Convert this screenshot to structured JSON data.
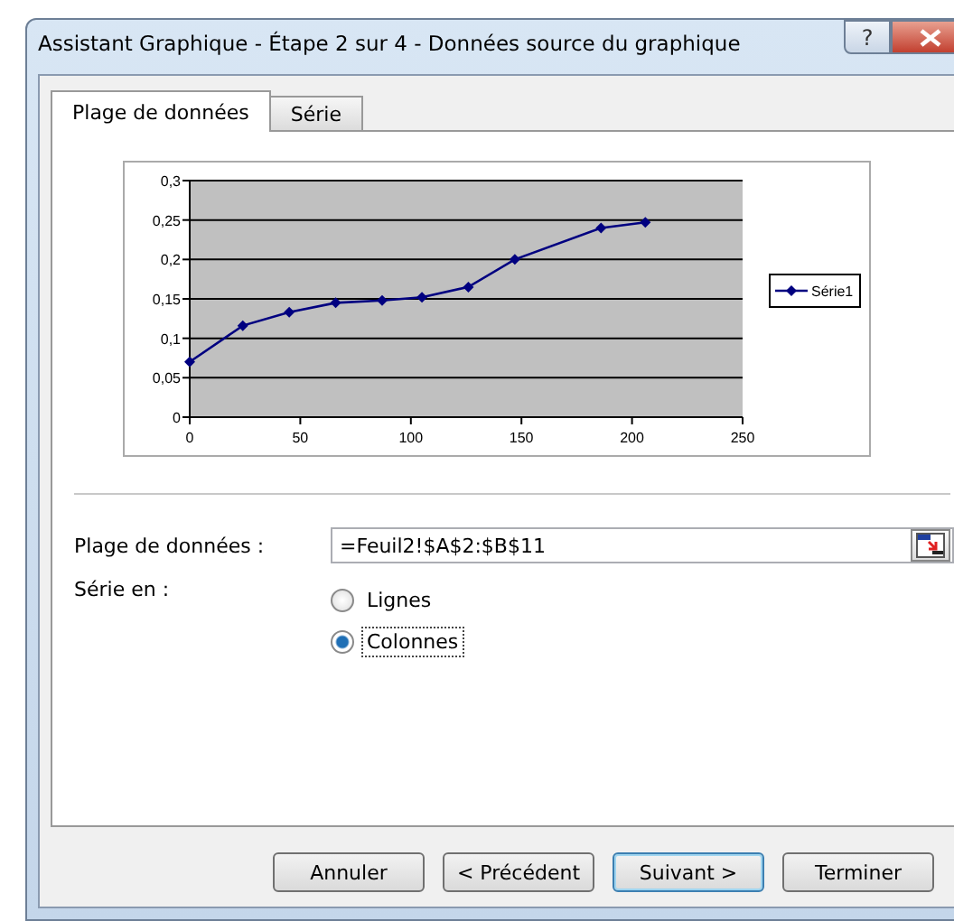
{
  "window": {
    "title": "Assistant Graphique - Étape 2 sur 4 - Données source du graphique",
    "help_button": "?"
  },
  "tabs": [
    {
      "label": "Plage de données",
      "selected": true
    },
    {
      "label": "Série",
      "selected": false
    }
  ],
  "chart": {
    "chart_data": {
      "type": "line",
      "grid": true,
      "x": [
        0,
        24,
        45,
        66,
        87,
        105,
        126,
        147,
        186,
        206
      ],
      "series": [
        {
          "name": "Série1",
          "color": "#000080",
          "marker": "diamond",
          "values": [
            0.07,
            0.116,
            0.133,
            0.145,
            0.148,
            0.152,
            0.165,
            0.2,
            0.24,
            0.247
          ]
        }
      ],
      "xlim": [
        0,
        250
      ],
      "ylim": [
        0,
        0.3
      ],
      "xticks": [
        0,
        50,
        100,
        150,
        200,
        250
      ],
      "yticks": [
        {
          "value": 0,
          "label": "0"
        },
        {
          "value": 0.05,
          "label": "0,05"
        },
        {
          "value": 0.1,
          "label": "0,1"
        },
        {
          "value": 0.15,
          "label": "0,15"
        },
        {
          "value": 0.2,
          "label": "0,2"
        },
        {
          "value": 0.25,
          "label": "0,25"
        },
        {
          "value": 0.3,
          "label": "0,3"
        }
      ]
    }
  },
  "range": {
    "label": "Plage de données :",
    "value": "=Feuil2!$A$2:$B$11"
  },
  "series_in": {
    "label": "Série en :",
    "options": [
      {
        "label": "Lignes",
        "selected": false
      },
      {
        "label": "Colonnes",
        "selected": true
      }
    ]
  },
  "buttons": [
    {
      "label": "Annuler",
      "default": false
    },
    {
      "label": "< Précédent",
      "default": false
    },
    {
      "label": "Suivant >",
      "default": true
    },
    {
      "label": "Terminer",
      "default": false
    }
  ]
}
